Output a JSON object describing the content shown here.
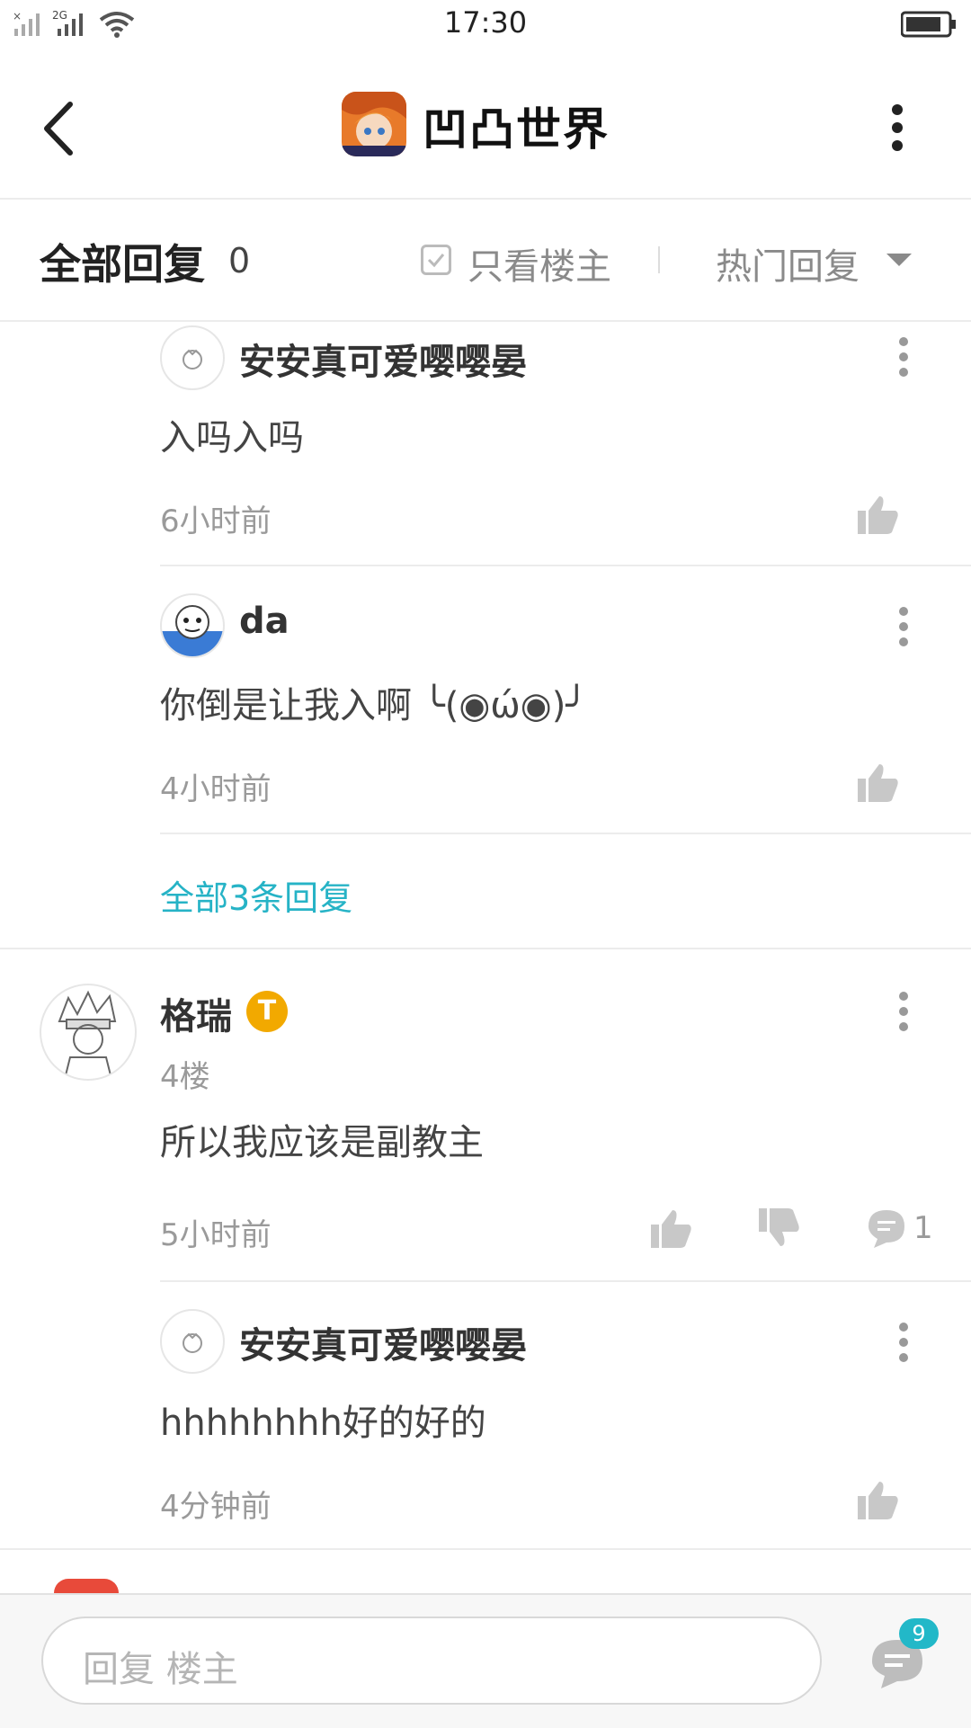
{
  "status": {
    "time": "17:30",
    "network": "2G"
  },
  "header": {
    "title": "凹凸世界"
  },
  "filter": {
    "all_replies_label": "全部回复",
    "reply_count": "0",
    "only_op_label": "只看楼主",
    "sort_label": "热门回复"
  },
  "comments": {
    "sub1": {
      "user": "安安真可爱嘤嘤晏",
      "text": "入吗入吗",
      "time": "6小时前"
    },
    "sub2": {
      "user": "da",
      "text": "你倒是让我入啊 ╰(◉ώ◉)╯",
      "time": "4小时前"
    },
    "view_all": "全部3条回复",
    "main": {
      "user": "格瑞",
      "badge": "T",
      "floor": "4楼",
      "text": "所以我应该是副教主",
      "time": "5小时前",
      "reply_count": "1"
    },
    "sub3": {
      "user": "安安真可爱嘤嘤晏",
      "text": "hhhhhhhh好的好的",
      "time": "4分钟前"
    }
  },
  "bottom": {
    "placeholder": "回复  楼主",
    "badge_count": "9"
  },
  "colors": {
    "accent": "#26b3c6",
    "badge": "#22b8c8",
    "gold": "#f2a900"
  }
}
